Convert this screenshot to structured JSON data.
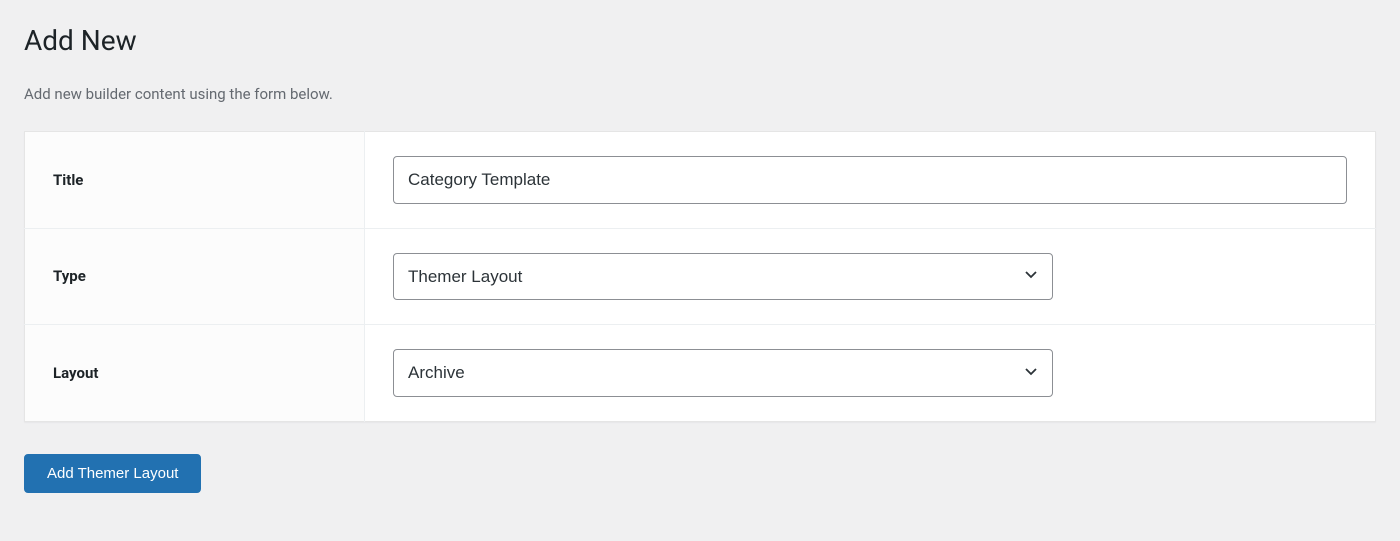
{
  "header": {
    "title": "Add New",
    "description": "Add new builder content using the form below."
  },
  "form": {
    "title": {
      "label": "Title",
      "value": "Category Template"
    },
    "type": {
      "label": "Type",
      "value": "Themer Layout"
    },
    "layout": {
      "label": "Layout",
      "value": "Archive"
    },
    "submit": {
      "label": "Add Themer Layout"
    }
  }
}
